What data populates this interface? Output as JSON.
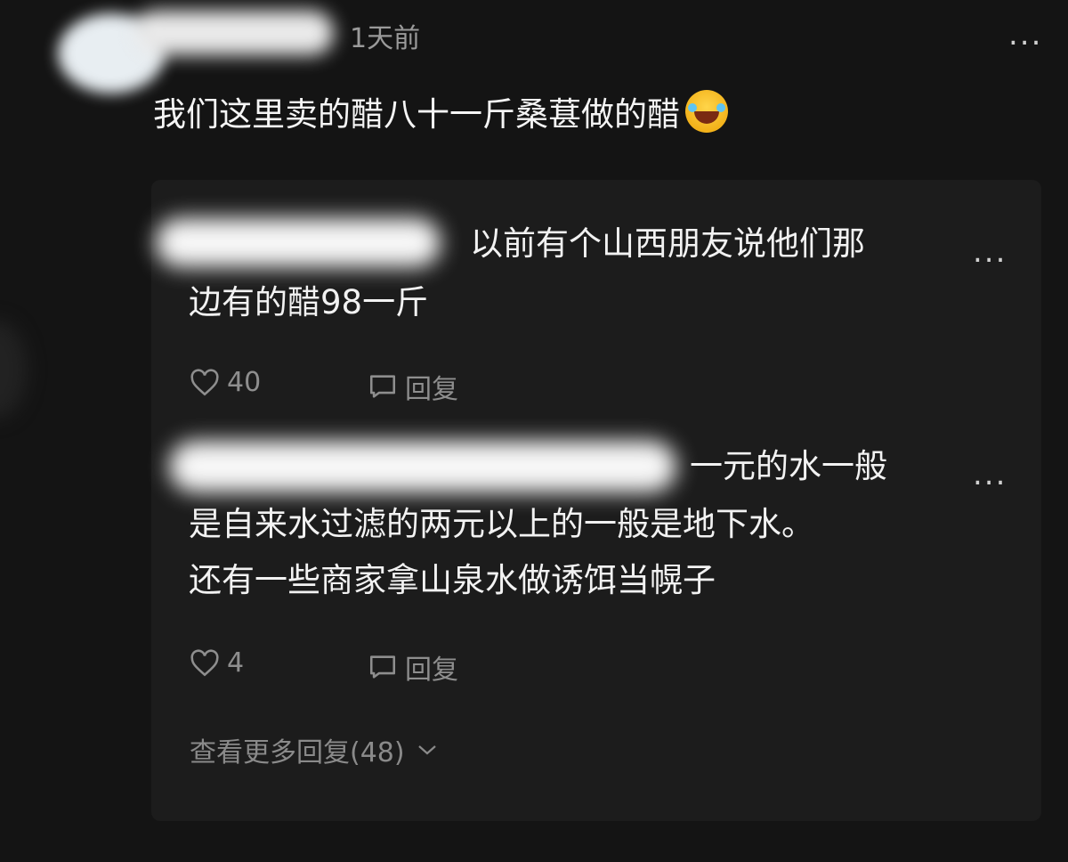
{
  "top_comment": {
    "timestamp": "1天前",
    "text": "我们这里卖的醋八十一斤桑葚做的醋",
    "emoji": "face-with-tears-of-joy-icon",
    "more_label": "..."
  },
  "replies": [
    {
      "line1": "以前有个山西朋友说他们那",
      "line2": "边有的醋98一斤",
      "likes": "40",
      "reply_label": "回复",
      "more_label": "..."
    },
    {
      "line1": "一元的水一般",
      "line2": "是自来水过滤的两元以上的一般是地下水。",
      "line3": "还有一些商家拿山泉水做诱饵当幌子",
      "likes": "4",
      "reply_label": "回复",
      "more_label": "..."
    }
  ],
  "view_more": "查看更多回复(48)"
}
